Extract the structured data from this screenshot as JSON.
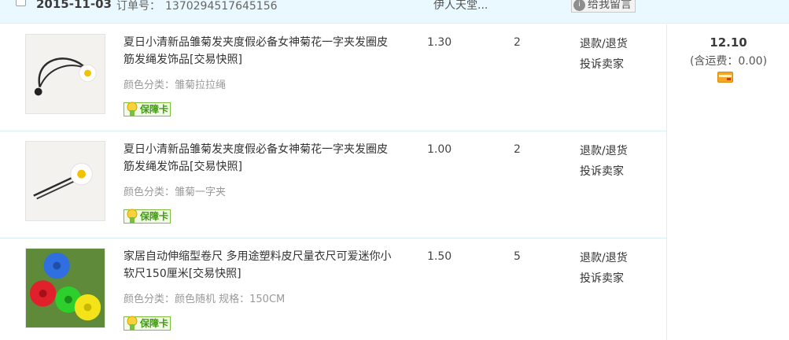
{
  "order": {
    "date": "2015-11-03",
    "order_no_label": "订单号：",
    "order_no": "1370294517645156",
    "shop_name": "伊人天堂...",
    "message_button": "给我留言",
    "message_icon_glyph": "i"
  },
  "items": [
    {
      "title": "夏日小清新品雏菊发夹度假必备女神菊花一字夹发圈皮筋发绳发饰品[交易快照]",
      "spec": "颜色分类：雏菊拉拉绳",
      "badge": "保障卡",
      "price": "1.30",
      "qty": "2",
      "action_refund": "退款/退货",
      "action_complain": "投诉卖家",
      "thumb_icon": "daisy-hair-tie"
    },
    {
      "title": "夏日小清新品雏菊发夹度假必备女神菊花一字夹发圈皮筋发绳发饰品[交易快照]",
      "spec": "颜色分类：雏菊一字夹",
      "badge": "保障卡",
      "price": "1.00",
      "qty": "2",
      "action_refund": "退款/退货",
      "action_complain": "投诉卖家",
      "thumb_icon": "daisy-hair-pin"
    },
    {
      "title": "家居自动伸缩型卷尺 多用途塑料皮尺量衣尺可爱迷你小软尺150厘米[交易快照]",
      "spec": "颜色分类：颜色随机  规格：150CM",
      "badge": "保障卡",
      "price": "1.50",
      "qty": "5",
      "action_refund": "退款/退货",
      "action_complain": "投诉卖家",
      "thumb_icon": "tape-measures"
    }
  ],
  "summary": {
    "total": "12.10",
    "shipping": "(含运费：0.00)",
    "payment_icon": "credit-card-icon"
  },
  "colors": {
    "header_bg": "#eaf8ff",
    "divider": "#d9eef8",
    "badge_green": "#3f9a10",
    "card_orange": "#f5a623"
  }
}
